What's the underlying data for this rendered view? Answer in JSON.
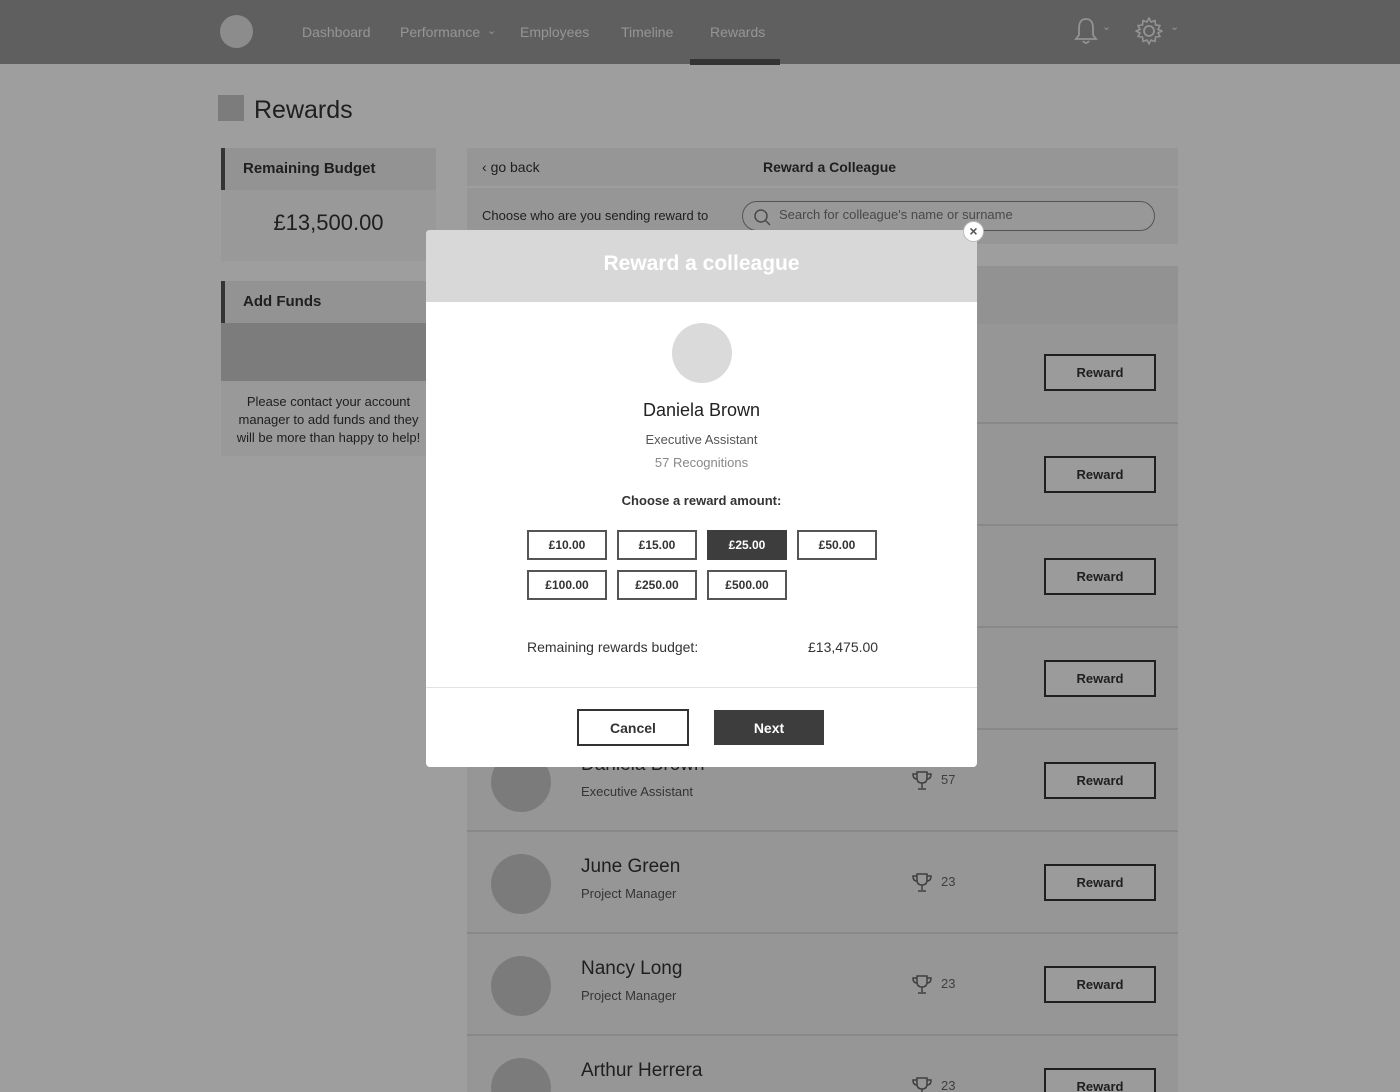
{
  "nav": {
    "items": [
      "Dashboard",
      "Performance",
      "Employees",
      "Timeline",
      "Rewards"
    ],
    "active": "Rewards"
  },
  "page": {
    "title": "Rewards"
  },
  "budget": {
    "heading": "Remaining Budget",
    "value": "£13,500.00"
  },
  "funds": {
    "heading": "Add Funds",
    "text": "Please contact your account manager to add funds and they will be more than happy to help!"
  },
  "content": {
    "back_label": "go back",
    "title": "Reward a Colleague",
    "choose_label": "Choose who are you sending reward to",
    "search_placeholder": "Search for colleague's name or surname",
    "reward_label": "Reward",
    "rows": [
      {
        "name": "",
        "role": "",
        "count": ""
      },
      {
        "name": "",
        "role": "",
        "count": ""
      },
      {
        "name": "",
        "role": "",
        "count": ""
      },
      {
        "name": "",
        "role": "",
        "count": ""
      },
      {
        "name": "Daniela Brown",
        "role": "Executive Assistant",
        "count": "57"
      },
      {
        "name": "June Green",
        "role": "Project Manager",
        "count": "23"
      },
      {
        "name": "Nancy Long",
        "role": "Project Manager",
        "count": "23"
      },
      {
        "name": "Arthur Herrera",
        "role": "",
        "count": "23"
      }
    ]
  },
  "modal": {
    "title": "Reward a colleague",
    "close_glyph": "×",
    "name": "Daniela Brown",
    "role": "Executive Assistant",
    "recognitions": "57 Recognitions",
    "choose_label": "Choose a reward amount:",
    "amounts": [
      "£10.00",
      "£15.00",
      "£25.00",
      "£50.00",
      "£100.00",
      "£250.00",
      "£500.00"
    ],
    "selected_amount": "£25.00",
    "remaining_label": "Remaining rewards budget:",
    "remaining_value": "£13,475.00",
    "cancel_label": "Cancel",
    "next_label": "Next"
  },
  "icons": {
    "bell": "bell-icon",
    "settings": "gear-icon",
    "search": "search-icon",
    "trophy": "trophy-icon",
    "back": "chevron-left-icon"
  }
}
